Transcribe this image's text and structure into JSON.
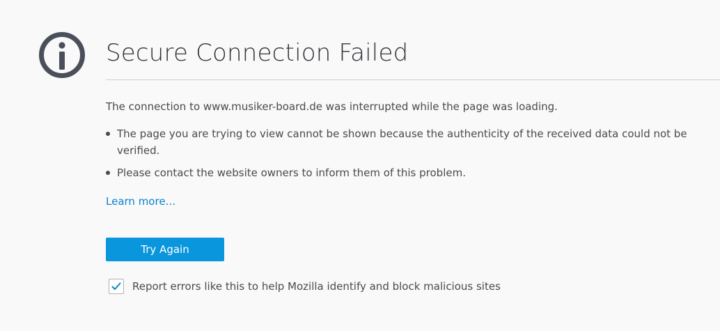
{
  "page": {
    "title": "Secure Connection Failed",
    "intro": "The connection to www.musiker-board.de was interrupted while the page was loading.",
    "bullets": [
      "The page you are trying to view cannot be shown because the authenticity of the received data could not be verified.",
      "Please contact the website owners to inform them of this problem."
    ],
    "learn_more": "Learn more…",
    "try_again_label": "Try Again",
    "report_checkbox": {
      "label": "Report errors like this to help Mozilla identify and block malicious sites",
      "checked": true
    }
  },
  "icons": {
    "header": "info-icon",
    "checkbox_mark": "checkmark-icon"
  },
  "colors": {
    "background": "#f9f9fa",
    "accent": "#0a96dc",
    "link": "#0a84c8",
    "icon": "#4a4f59",
    "text": "#4a4a4f"
  }
}
